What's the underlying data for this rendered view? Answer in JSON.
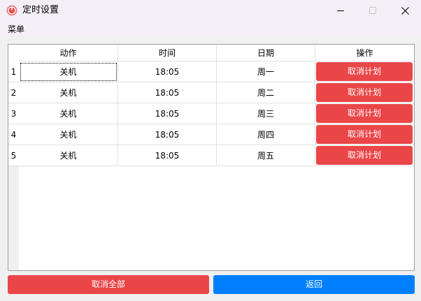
{
  "window": {
    "title": "定时设置",
    "icon": "power-icon",
    "controls": [
      "minimize",
      "maximize",
      "close"
    ]
  },
  "menu": {
    "label": "菜单"
  },
  "table": {
    "columns": [
      "动作",
      "时间",
      "日期",
      "操作"
    ],
    "rows": [
      {
        "index": "1",
        "action": "关机",
        "time": "18:05",
        "day": "周一",
        "op": "取消计划"
      },
      {
        "index": "2",
        "action": "关机",
        "time": "18:05",
        "day": "周二",
        "op": "取消计划"
      },
      {
        "index": "3",
        "action": "关机",
        "time": "18:05",
        "day": "周三",
        "op": "取消计划"
      },
      {
        "index": "4",
        "action": "关机",
        "time": "18:05",
        "day": "周四",
        "op": "取消计划"
      },
      {
        "index": "5",
        "action": "关机",
        "time": "18:05",
        "day": "周五",
        "op": "取消计划"
      }
    ]
  },
  "buttons": {
    "cancel_all": "取消全部",
    "back": "返回"
  },
  "colors": {
    "danger": "#ea4648",
    "primary": "#0080ff",
    "titlebar": "#f4eef7"
  }
}
